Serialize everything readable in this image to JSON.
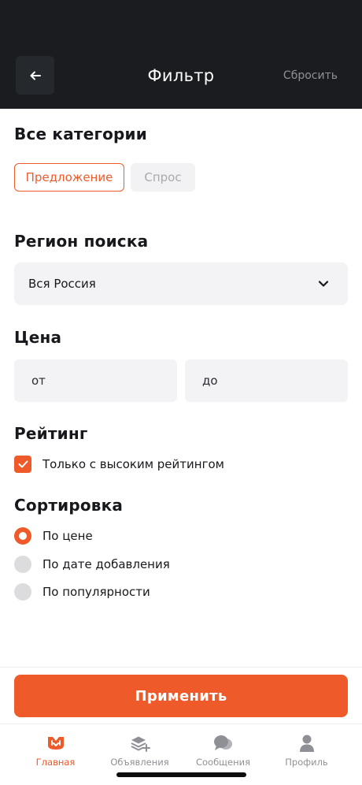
{
  "header": {
    "title": "Фильтр",
    "reset_label": "Сбросить"
  },
  "categories": {
    "title": "Все категории",
    "chips": [
      "Предложение",
      "Спрос"
    ],
    "selected": "Предложение"
  },
  "region": {
    "title": "Регион поиска",
    "value": "Вся Россия"
  },
  "price": {
    "title": "Цена",
    "from_placeholder": "от",
    "to_placeholder": "до"
  },
  "rating": {
    "title": "Рейтинг",
    "checkbox_label": "Только с высоким рейтингом",
    "checked": true
  },
  "sort": {
    "title": "Сортировка",
    "options": [
      "По цене",
      "По дате добавления",
      "По популярности"
    ],
    "selected": "По цене"
  },
  "apply_label": "Применить",
  "tabbar": {
    "items": [
      {
        "label": "Главная",
        "icon": "home-logo-icon",
        "active": true
      },
      {
        "label": "Объявления",
        "icon": "ads-stack-icon",
        "active": false
      },
      {
        "label": "Сообщения",
        "icon": "messages-icon",
        "active": false
      },
      {
        "label": "Профиль",
        "icon": "profile-icon",
        "active": false
      }
    ]
  },
  "colors": {
    "accent": "#ee5a2a",
    "header_bg": "#1a1c20",
    "field_bg": "#f3f3f5"
  }
}
